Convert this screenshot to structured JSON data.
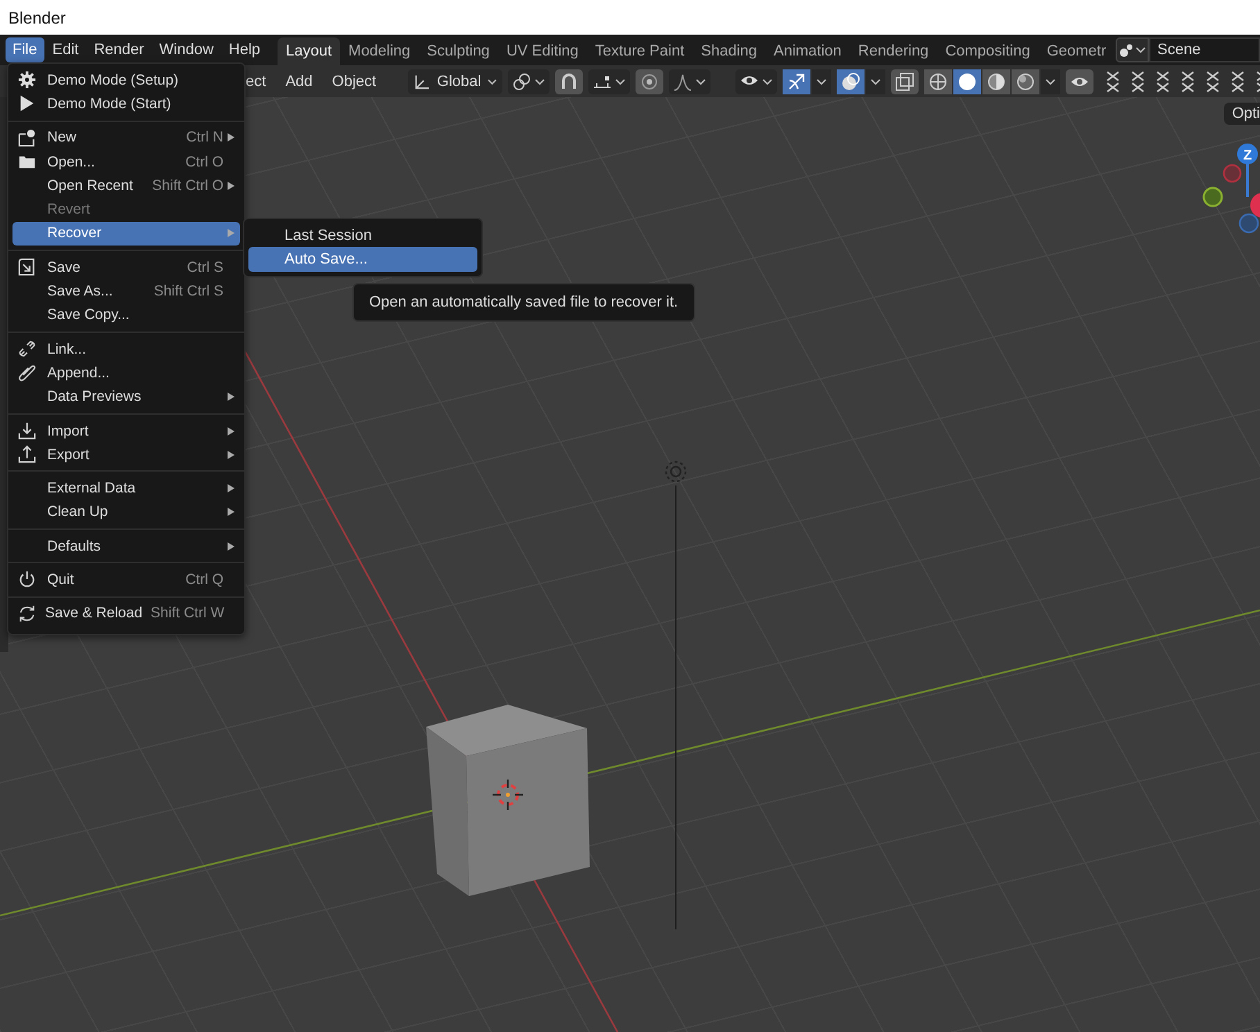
{
  "window": {
    "title": "Blender"
  },
  "menu_bar": [
    {
      "label": "File",
      "selected": true
    },
    {
      "label": "Edit",
      "selected": false
    },
    {
      "label": "Render",
      "selected": false
    },
    {
      "label": "Window",
      "selected": false
    },
    {
      "label": "Help",
      "selected": false
    }
  ],
  "workspace_tabs": [
    {
      "label": "Layout",
      "selected": true
    },
    {
      "label": "Modeling",
      "selected": false
    },
    {
      "label": "Sculpting",
      "selected": false
    },
    {
      "label": "UV Editing",
      "selected": false
    },
    {
      "label": "Texture Paint",
      "selected": false
    },
    {
      "label": "Shading",
      "selected": false
    },
    {
      "label": "Animation",
      "selected": false
    },
    {
      "label": "Rendering",
      "selected": false
    },
    {
      "label": "Compositing",
      "selected": false
    },
    {
      "label": "Geometr",
      "selected": false
    }
  ],
  "scene_selector": {
    "value": "Scene"
  },
  "header": {
    "menus": [
      "ect",
      "Add",
      "Object"
    ],
    "orientation": "Global",
    "toggles": [
      {
        "selected": true
      },
      {
        "selected": true
      }
    ],
    "shading_modes": [
      {
        "selected": false
      },
      {
        "selected": true
      },
      {
        "selected": false
      },
      {
        "selected": false
      }
    ]
  },
  "viewport": {
    "options_button": "Opti",
    "gizmo_axis_label": "Z"
  },
  "file_menu": {
    "sections": [
      [
        {
          "label": "Demo Mode (Setup)",
          "submenu": false,
          "disabled": false,
          "selected": false
        },
        {
          "label": "Demo Mode (Start)",
          "submenu": false,
          "disabled": false,
          "selected": false
        }
      ],
      [
        {
          "label": "New",
          "shortcut": "Ctrl N",
          "submenu": true,
          "disabled": false,
          "selected": false
        },
        {
          "label": "Open...",
          "shortcut": "Ctrl O",
          "submenu": false,
          "disabled": false,
          "selected": false
        },
        {
          "label": "Open Recent",
          "shortcut": "Shift Ctrl O",
          "submenu": true,
          "disabled": false,
          "selected": false
        },
        {
          "label": "Revert",
          "submenu": false,
          "disabled": true,
          "selected": false
        },
        {
          "label": "Recover",
          "submenu": true,
          "disabled": false,
          "selected": true
        }
      ],
      [
        {
          "label": "Save",
          "shortcut": "Ctrl S",
          "submenu": false,
          "disabled": false,
          "selected": false
        },
        {
          "label": "Save As...",
          "shortcut": "Shift Ctrl S",
          "submenu": false,
          "disabled": false,
          "selected": false
        },
        {
          "label": "Save Copy...",
          "submenu": false,
          "disabled": false,
          "selected": false
        }
      ],
      [
        {
          "label": "Link...",
          "submenu": false,
          "disabled": false,
          "selected": false
        },
        {
          "label": "Append...",
          "submenu": false,
          "disabled": false,
          "selected": false
        },
        {
          "label": "Data Previews",
          "submenu": true,
          "disabled": false,
          "selected": false
        }
      ],
      [
        {
          "label": "Import",
          "submenu": true,
          "disabled": false,
          "selected": false
        },
        {
          "label": "Export",
          "submenu": true,
          "disabled": false,
          "selected": false
        }
      ],
      [
        {
          "label": "External Data",
          "submenu": true,
          "disabled": false,
          "selected": false
        },
        {
          "label": "Clean Up",
          "submenu": true,
          "disabled": false,
          "selected": false
        }
      ],
      [
        {
          "label": "Defaults",
          "submenu": true,
          "disabled": false,
          "selected": false
        }
      ],
      [
        {
          "label": "Quit",
          "shortcut": "Ctrl Q",
          "submenu": false,
          "disabled": false,
          "selected": false
        }
      ],
      [
        {
          "label": "Save & Reload",
          "shortcut": "Shift Ctrl W",
          "submenu": false,
          "disabled": false,
          "selected": false
        }
      ]
    ]
  },
  "recover_submenu": {
    "items": [
      {
        "label": "Last Session",
        "selected": false
      },
      {
        "label": "Auto Save...",
        "selected": true
      }
    ]
  },
  "tooltip": "Open an automatically saved file to recover it."
}
